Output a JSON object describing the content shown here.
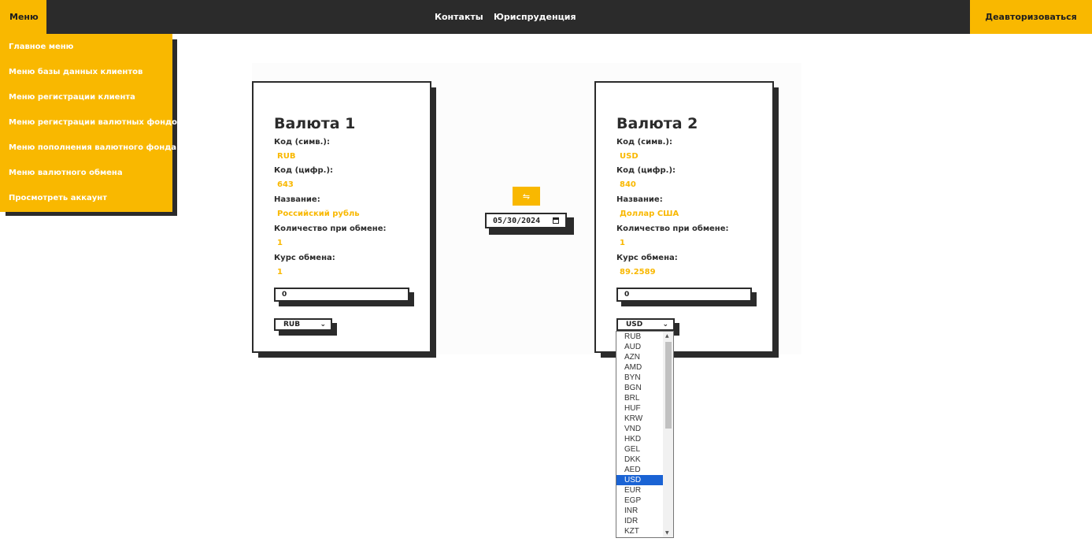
{
  "topbar": {
    "menu_label": "Меню",
    "links": [
      "Контакты",
      "Юриспруденция"
    ],
    "logout_label": "Деавторизоваться"
  },
  "side_menu": {
    "items": [
      "Главное меню",
      "Меню базы данных клиентов",
      "Меню регистрации клиента",
      "Меню регистрации валютных фондов",
      "Меню пополнения валютного фонда",
      "Меню валютного обмена",
      "Просмотреть аккаунт"
    ]
  },
  "currency1": {
    "title": "Валюта 1",
    "code_sym_label": "Код (симв.):",
    "code_sym": "RUB",
    "code_num_label": "Код (цифр.):",
    "code_num": "643",
    "name_label": "Название:",
    "name": "Российский рубль",
    "qty_label": "Количество при обмене:",
    "qty": "1",
    "rate_label": "Курс обмена:",
    "rate": "1",
    "amount": "0",
    "selected": "RUB"
  },
  "currency2": {
    "title": "Валюта 2",
    "code_sym_label": "Код (симв.):",
    "code_sym": "USD",
    "code_num_label": "Код (цифр.):",
    "code_num": "840",
    "name_label": "Название:",
    "name": "Доллар США",
    "qty_label": "Количество при обмене:",
    "qty": "1",
    "rate_label": "Курс обмена:",
    "rate": "89.2589",
    "amount": "0",
    "selected": "USD"
  },
  "middle": {
    "swap_icon": "⇋",
    "date": "05/30/2024"
  },
  "dropdown": {
    "options": [
      "RUB",
      "AUD",
      "AZN",
      "AMD",
      "BYN",
      "BGN",
      "BRL",
      "HUF",
      "KRW",
      "VND",
      "HKD",
      "GEL",
      "DKK",
      "AED",
      "USD",
      "EUR",
      "EGP",
      "INR",
      "IDR",
      "KZT"
    ],
    "selected": "USD"
  },
  "colors": {
    "accent": "#f9b800",
    "dark": "#2b2b2b",
    "selection": "#1a63d4"
  }
}
